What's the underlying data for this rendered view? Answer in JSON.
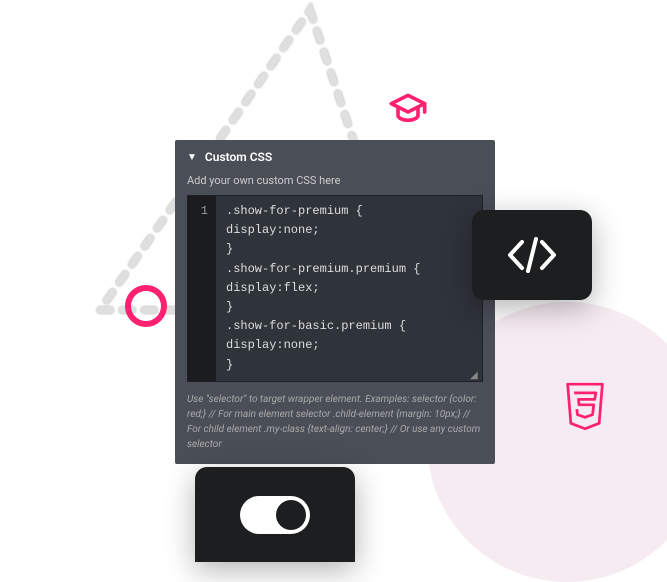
{
  "panel": {
    "title": "Custom CSS",
    "subtitle": "Add your own custom CSS here",
    "line_number": "1",
    "code": ".show-for-premium {\ndisplay:none;\n}\n.show-for-premium.premium {\ndisplay:flex;\n}\n.show-for-basic.premium {\ndisplay:none;\n}",
    "help": "Use \"selector\" to target wrapper element. Examples:\nselector {color: red;} // For main element\nselector .child-element {margin: 10px;} // For child element\n.my-class {text-align: center;} // Or use any custom selector"
  },
  "icons": {
    "code": "code-icon",
    "css3": "css3-icon",
    "graduation": "graduation-cap-icon",
    "toggle": "toggle-switch"
  },
  "colors": {
    "accent": "#ff2171",
    "panel_bg": "#4a4e57",
    "card_bg": "#1d1e1f"
  }
}
